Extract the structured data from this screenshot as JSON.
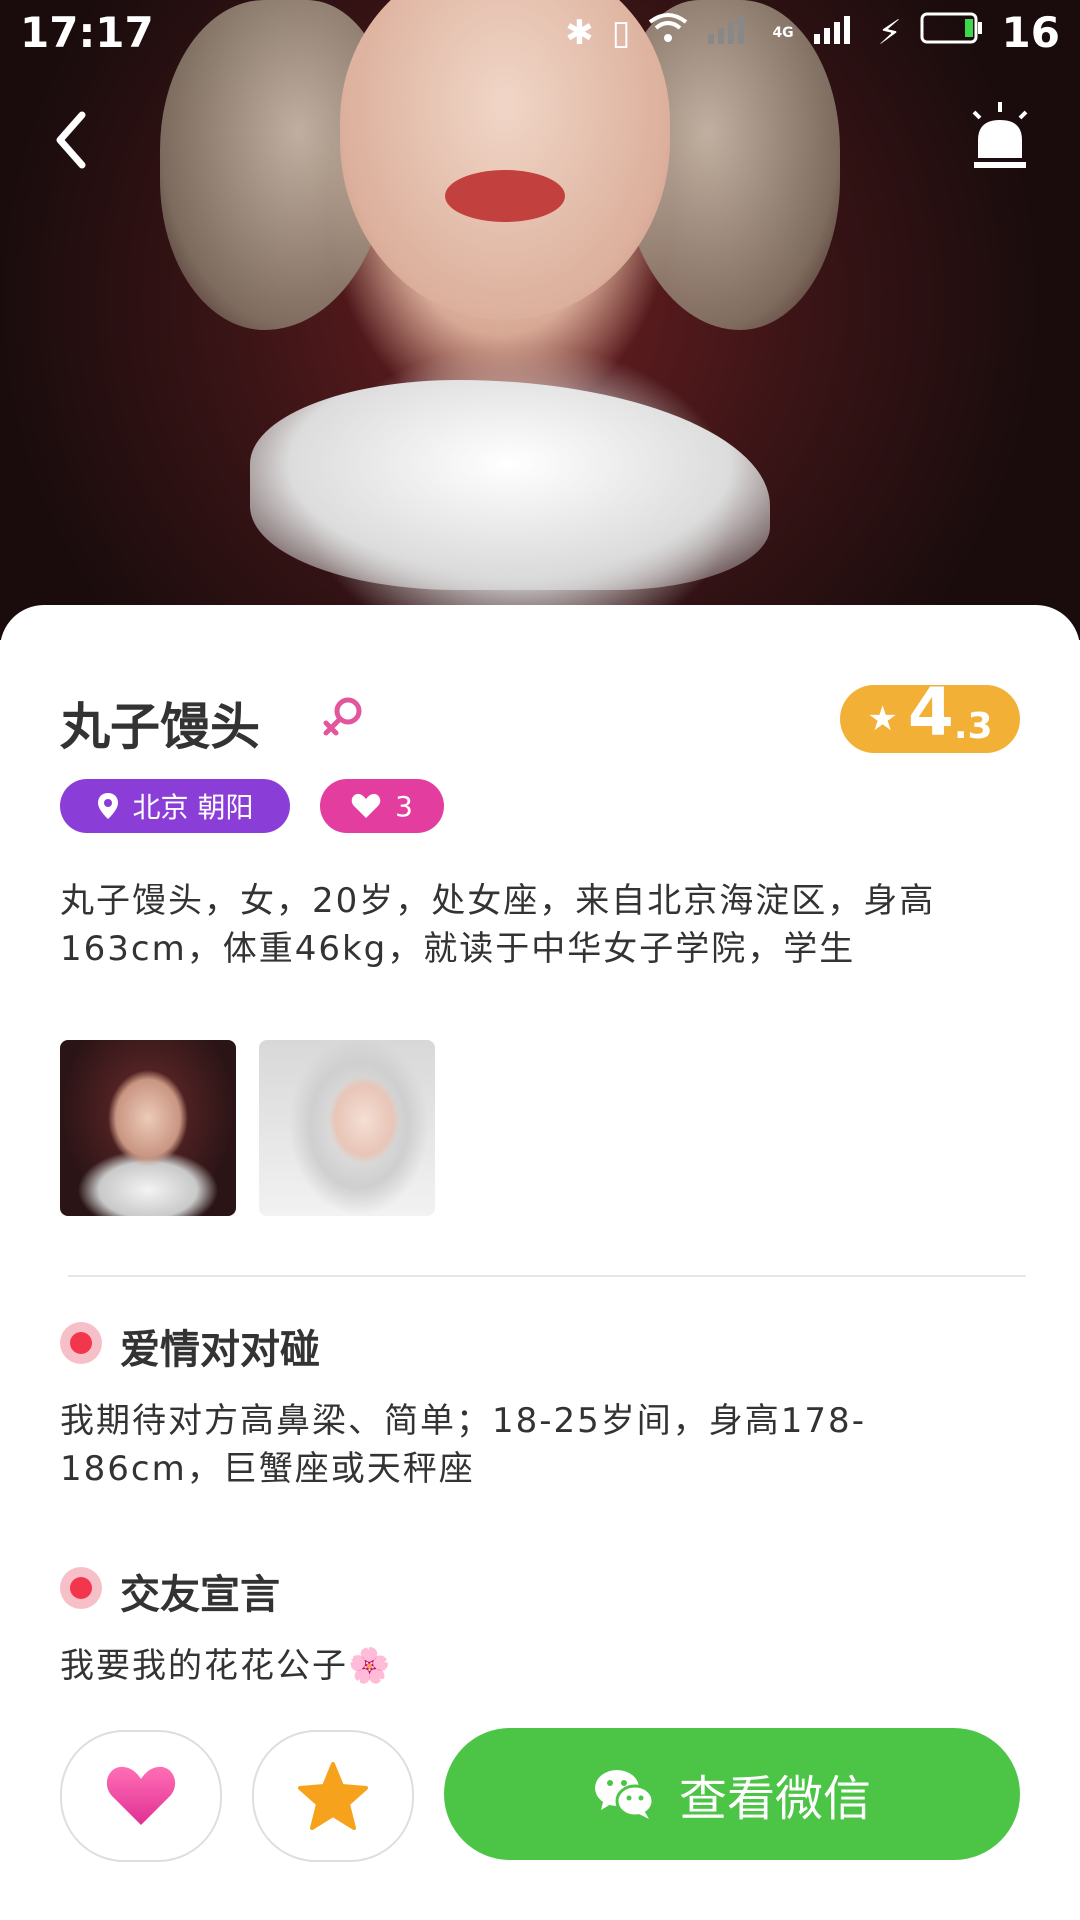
{
  "status_bar": {
    "time": "17:17",
    "network": "4G",
    "battery": "16"
  },
  "profile": {
    "name": "丸子馒头",
    "gender_icon": "female-icon",
    "rating_int": "4",
    "rating_dec": ".3",
    "location": "北京 朝阳",
    "likes": "3",
    "intro": "丸子馒头，女，20岁，处女座，来自北京海淀区，身高163cm，体重46kg，就读于中华女子学院，学生"
  },
  "sections": [
    {
      "title": "爱情对对碰",
      "text": "我期待对方高鼻梁、简单；18-25岁间，身高178-186cm，巨蟹座或天秤座"
    },
    {
      "title": "交友宣言",
      "text": "我要我的花花公子🌸"
    }
  ],
  "actions": {
    "wechat_label": "查看微信"
  },
  "colors": {
    "location_tag": "#8b3ed7",
    "like_tag": "#e23d9f",
    "rating": "#f2b136",
    "wechat_button": "#4cc445",
    "section_dot": "#f2374d"
  }
}
